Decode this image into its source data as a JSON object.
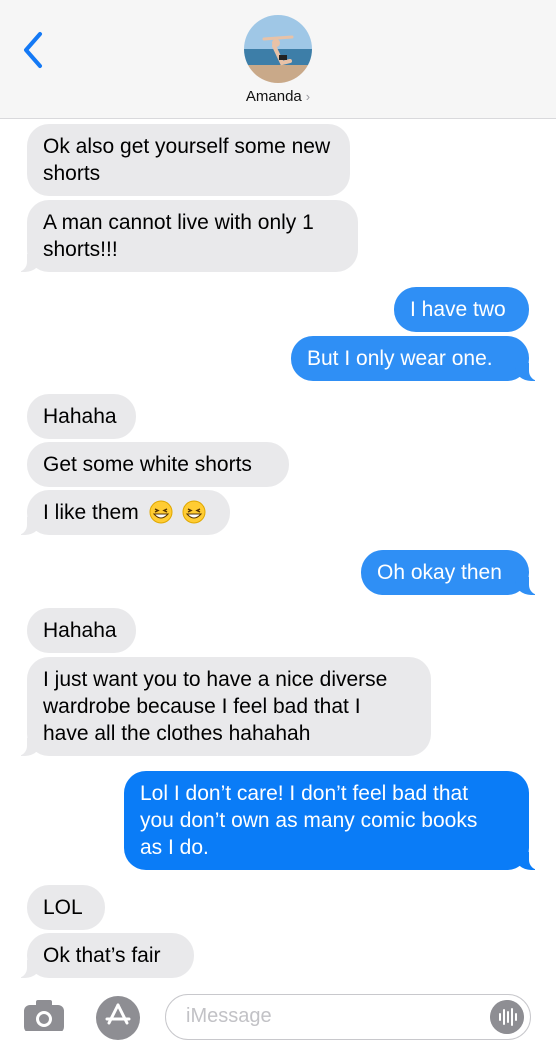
{
  "header": {
    "contact_name": "Amanda",
    "chevron": "›"
  },
  "messages": [
    {
      "direction": "in",
      "lines": [
        "Ok also get yourself some new",
        "shorts"
      ]
    },
    {
      "direction": "in",
      "lines": [
        "A man cannot live with only 1",
        "shorts!!!"
      ]
    },
    {
      "direction": "out",
      "text": "I have two"
    },
    {
      "direction": "out",
      "text": "But I only wear one."
    },
    {
      "direction": "in",
      "text": "Hahaha"
    },
    {
      "direction": "in",
      "text": "Get some white shorts"
    },
    {
      "direction": "in",
      "text": "I like them",
      "emoji": "grinning-squinting-face"
    },
    {
      "direction": "out",
      "text": "Oh okay then"
    },
    {
      "direction": "in",
      "text": "Hahaha"
    },
    {
      "direction": "in",
      "lines": [
        "I just want you to have a nice diverse",
        "wardrobe because I feel bad that I",
        "have all the clothes hahahah"
      ]
    },
    {
      "direction": "out",
      "lines": [
        "Lol I don’t care! I don’t feel bad that",
        "you don’t own as many comic books",
        "as I do."
      ]
    },
    {
      "direction": "in",
      "text": "LOL"
    },
    {
      "direction": "in",
      "text": "Ok that’s fair"
    }
  ],
  "composer": {
    "placeholder": "iMessage"
  },
  "colors": {
    "incoming_bubble": "#e9e9eb",
    "outgoing_bubble": "#2f8ff5",
    "accent": "#0a7cf7"
  }
}
